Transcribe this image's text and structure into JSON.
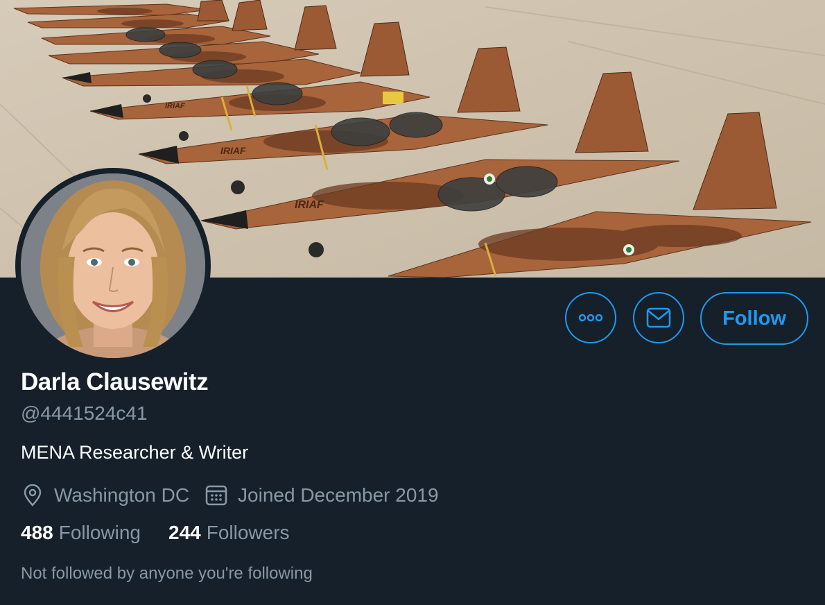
{
  "profile": {
    "display_name": "Darla Clausewitz",
    "handle": "@4441524c41",
    "bio": "MENA Researcher & Writer",
    "location": "Washington DC",
    "joined": "Joined December 2019",
    "following_count": "488",
    "following_label": "Following",
    "followers_count": "244",
    "followers_label": "Followers",
    "followed_by_note": "Not followed by anyone you're following"
  },
  "banner": {
    "aircraft_marking": "IRIAF",
    "content": "photo of a row of desert-camouflage jet fighters on a tarmac"
  },
  "actions": {
    "more_icon": "more-icon",
    "message_icon": "mail-icon",
    "follow_label": "Follow"
  },
  "icons": {
    "location": "location-pin-icon",
    "calendar": "calendar-icon"
  },
  "colors": {
    "background": "#15202b",
    "accent": "#1d9bf0",
    "muted_text": "#8899a6",
    "text": "#ffffff"
  }
}
